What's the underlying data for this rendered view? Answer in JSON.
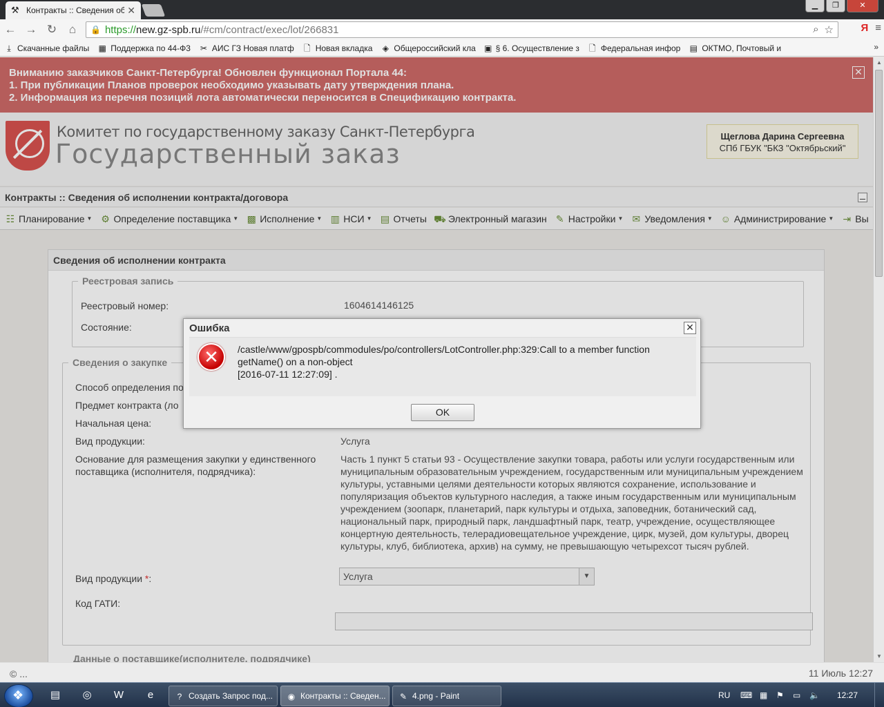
{
  "browser": {
    "tab_title": "Контракты :: Сведения об",
    "url_scheme": "https://",
    "url_host": "new.gz-spb.ru",
    "url_path": "/#cm/contract/exec/lot/266831",
    "yandex": "Я",
    "bookmarks": [
      {
        "icon": "download-icon",
        "glyph": "⤓",
        "label": "Скачанные файлы"
      },
      {
        "icon": "favicon-44",
        "glyph": "▦",
        "label": "Поддержка по 44-Ф3"
      },
      {
        "icon": "favicon-ais",
        "glyph": "✂",
        "label": "АИС ГЗ Новая платф"
      },
      {
        "icon": "page-icon",
        "glyph": "🗋",
        "label": "Новая вкладка"
      },
      {
        "icon": "favicon-zakupki",
        "glyph": "◈",
        "label": "Общероссийский кла"
      },
      {
        "icon": "favicon-consultant",
        "glyph": "▣",
        "label": "§ 6. Осуществление з"
      },
      {
        "icon": "page-icon",
        "glyph": "🗋",
        "label": "Федеральная инфор"
      },
      {
        "icon": "favicon-oktmo",
        "glyph": "▤",
        "label": "ОКТМО, Почтовый и"
      }
    ],
    "bookmarks_more": "»"
  },
  "notice": {
    "line1": "Вниманию заказчиков Санкт-Петербурга! Обновлен функционал Портала 44:",
    "line2": "1. При публикации Планов проверок необходимо указывать дату утверждения плана.",
    "line3": "2. Информация из перечня позиций лота автоматически переносится в Спецификацию контракта.",
    "close": "✕"
  },
  "header": {
    "org_name": "Комитет по государственному заказу Санкт-Петербурга",
    "site_name": "Государственный заказ",
    "user_name": "Щеглова Дарина Сергеевна",
    "user_org": "СПб ГБУК \"БКЗ \"Октябрьский\""
  },
  "breadcrumb": "Контракты :: Сведения об исполнении контракта/договора",
  "menu": [
    {
      "name": "menu-planning",
      "icon": "planning-icon",
      "glyph": "☷",
      "label": "Планирование",
      "caret": true
    },
    {
      "name": "menu-supplier",
      "icon": "gears-icon",
      "glyph": "⚙",
      "label": "Определение поставщика",
      "caret": true
    },
    {
      "name": "menu-execution",
      "icon": "briefcase-icon",
      "glyph": "▩",
      "label": "Исполнение",
      "caret": true
    },
    {
      "name": "menu-nsi",
      "icon": "book-icon",
      "glyph": "▥",
      "label": "НСИ",
      "caret": true
    },
    {
      "name": "menu-reports",
      "icon": "report-icon",
      "glyph": "▤",
      "label": "Отчеты",
      "caret": false
    },
    {
      "name": "menu-eshop",
      "icon": "cart-icon",
      "glyph": "⛟",
      "label": "Электронный магазин",
      "caret": false
    },
    {
      "name": "menu-settings",
      "icon": "wrench-icon",
      "glyph": "✎",
      "label": "Настройки",
      "caret": true
    },
    {
      "name": "menu-notifications",
      "icon": "bell-icon",
      "glyph": "✉",
      "label": "Уведомления",
      "caret": true
    },
    {
      "name": "menu-admin",
      "icon": "user-icon",
      "glyph": "☺",
      "label": "Администрирование",
      "caret": true
    },
    {
      "name": "menu-exit",
      "icon": "exit-icon",
      "glyph": "⇥",
      "label": "Вы",
      "caret": false
    }
  ],
  "panel": {
    "title": "Сведения об исполнении контракта",
    "registry": {
      "legend": "Реестровая запись",
      "number_label": "Реестровый номер:",
      "number_value": "1604614146125",
      "state_label": "Состояние:"
    },
    "purchase": {
      "legend": "Сведения о закупке",
      "method_label": "Способ определения по",
      "subject_label": "Предмет контракта (ло",
      "price_label": "Начальная цена:",
      "product_type_label": "Вид продукции:",
      "product_type_value": "Услуга",
      "basis_label": "Основание для размещения закупки у единственного поставщика (исполнителя, подрядчика):",
      "basis_value": "Часть 1 пункт 5 статьи 93 - Осуществление закупки товара, работы или услуги государственным или муниципальным образовательным учреждением, государственным или муниципальным учреждением культуры, уставными целями деятельности которых являются сохранение, использование и популяризация объектов культурного наследия, а также иным государственным или муниципальным учреждением (зоопарк, планетарий, парк культуры и отдыха, заповедник, ботанический сад, национальный парк, природный парк, ландшафтный парк, театр, учреждение, осуществляющее концертную деятельность, телерадиовещательное учреждение, цирк, музей, дом культуры, дворец культуры, клуб, библиотека, архив) на сумму, не превышающую четырехсот тысяч рублей.",
      "product_type2_label": "Вид продукции",
      "required_mark": "*",
      "colon": ":",
      "product_type2_value": "Услуга",
      "gati_label": "Код ГАТИ:",
      "gati_value": ""
    },
    "supplier_legend": "Данные о поставщике(исполнителе, подрядчике)"
  },
  "dialog": {
    "title": "Ошибка",
    "close": "✕",
    "message_line1": "/castle/www/gpospb/commodules/po/controllers/LotController.php:329:Call to a member function",
    "message_line2": "getName() on a non-object",
    "message_line3": "[2016-07-11 12:27:09] .",
    "ok": "OK"
  },
  "status": {
    "left": "© ...",
    "right": "11 Июль 12:27"
  },
  "taskbar": {
    "tasks": [
      {
        "name": "task-ie-request",
        "icon": "help-icon",
        "glyph": "?",
        "label": "Создать Запрос под..."
      },
      {
        "name": "task-chrome",
        "icon": "chrome-icon",
        "glyph": "◉",
        "label": "Контракты :: Сведен..."
      },
      {
        "name": "task-paint",
        "icon": "paint-icon",
        "glyph": "✎",
        "label": "4.png - Paint"
      }
    ],
    "lang": "RU",
    "clock": "12:27"
  }
}
